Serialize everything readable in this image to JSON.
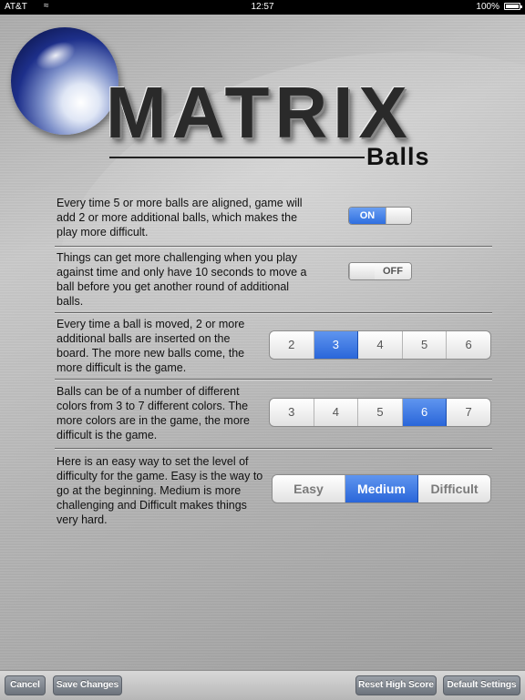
{
  "status_bar": {
    "carrier": "AT&T",
    "time": "12:57",
    "battery": "100%"
  },
  "logo": {
    "title": "MATRIX",
    "subtitle": "Balls"
  },
  "settings": {
    "add_balls": {
      "description": "Every time 5 or more balls are aligned, game will add 2 or more additional balls, which makes the play more difficult.",
      "toggle_label": "ON",
      "state": "on"
    },
    "time_limit": {
      "description": "Things can get more challenging when you play against time and only have 10 seconds to move a ball before you get another round of additional balls.",
      "toggle_label": "OFF",
      "state": "off"
    },
    "balls_per_move": {
      "description": "Every time a ball is moved, 2 or more additional balls are inserted on the board. The more new balls come, the more difficult is the game.",
      "options": [
        "2",
        "3",
        "4",
        "5",
        "6"
      ],
      "selected": "3"
    },
    "colors": {
      "description": "Balls can be of a number of different colors from 3 to 7 different colors. The more colors are in the game, the more difficult is the game.",
      "options": [
        "3",
        "4",
        "5",
        "6",
        "7"
      ],
      "selected": "6"
    },
    "difficulty": {
      "description": "Here is an easy way to set the level of difficulty for the game. Easy is the way to go at the beginning. Medium is more challenging and Difficult makes things very hard.",
      "options": [
        "Easy",
        "Medium",
        "Difficult"
      ],
      "selected": "Medium"
    }
  },
  "toolbar": {
    "cancel": "Cancel",
    "save": "Save Changes",
    "reset": "Reset High Score",
    "defaults": "Default Settings"
  },
  "colors": {
    "accent": "#2f6fe0",
    "toolbar_button": "#7a818a"
  }
}
